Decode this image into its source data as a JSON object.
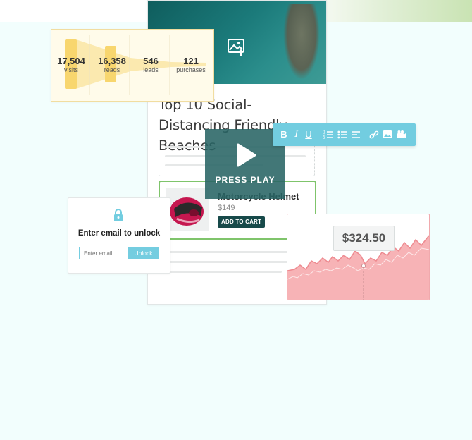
{
  "article": {
    "title": "Top 10 Social-Distancing Friendly Beaches",
    "hero_icon": "image-upload-icon"
  },
  "product": {
    "name": "Motorcycle Helmet",
    "price": "$149",
    "cart_label": "ADD TO CART"
  },
  "video": {
    "play_label": "PRESS PLAY"
  },
  "toolbar": {
    "items": [
      "B",
      "I",
      "U",
      "ordered-list-icon",
      "bullet-list-icon",
      "align-left-icon",
      "link-icon",
      "image-icon",
      "video-icon"
    ]
  },
  "funnel": {
    "stages": [
      {
        "value": "17,504",
        "label": "visits"
      },
      {
        "value": "16,358",
        "label": "reads"
      },
      {
        "value": "546",
        "label": "leads"
      },
      {
        "value": "121",
        "label": "purchases"
      }
    ]
  },
  "lock": {
    "title": "Enter email to unlock",
    "placeholder": "Enter email",
    "button": "Unlock"
  },
  "stock": {
    "price": "$324.50"
  },
  "colors": {
    "accent": "#72cde0",
    "green": "#7fc46b",
    "dark": "#174a4a",
    "red": "#f0a9ad"
  }
}
